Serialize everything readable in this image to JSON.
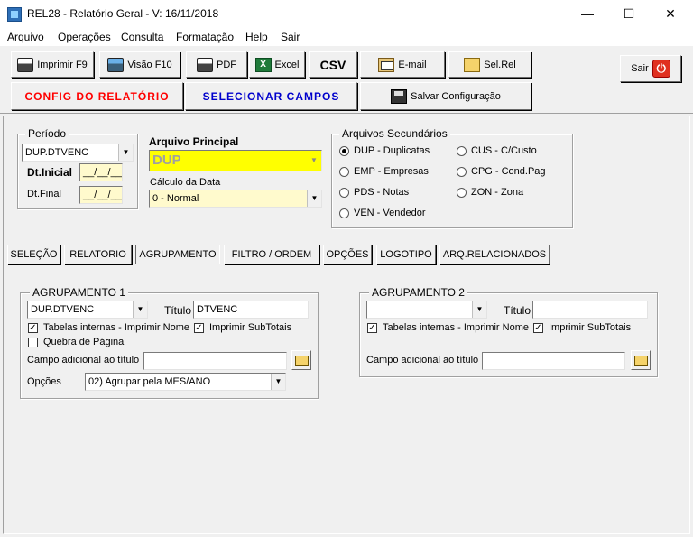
{
  "window": {
    "title": "REL28 - Relatório Geral - V: 16/11/2018",
    "minimize": "—",
    "maximize": "☐",
    "close": "✕"
  },
  "menu": [
    "Arquivo",
    "Operações",
    "Consulta",
    "Formatação",
    "Help",
    "Sair"
  ],
  "toolbar": {
    "print": "Imprimir F9",
    "preview": "Visão F10",
    "pdf": "PDF",
    "excel": "Excel",
    "csv": "CSV",
    "email": "E-mail",
    "selrel": "Sel.Rel",
    "exit": "Sair",
    "config": "CONFIG DO RELATÓRIO",
    "select_fields": "SELECIONAR CAMPOS",
    "save_config": "Salvar Configuração"
  },
  "periodo": {
    "legend": "Período",
    "field": "DUP.DTVENC",
    "dt_inicial_label": "Dt.Inicial",
    "dt_inicial": "__/__/__",
    "dt_final_label": "Dt.Final",
    "dt_final": "__/__/__"
  },
  "arquivo_principal": {
    "label": "Arquivo Principal",
    "value": "DUP",
    "calc_label": "Cálculo da Data",
    "calc_value": "0 - Normal"
  },
  "arquivos_secundarios": {
    "legend": "Arquivos Secundários",
    "options": [
      {
        "label": "DUP - Duplicatas",
        "selected": true
      },
      {
        "label": "EMP - Empresas",
        "selected": false
      },
      {
        "label": "PDS - Notas",
        "selected": false
      },
      {
        "label": "VEN - Vendedor",
        "selected": false
      },
      {
        "label": "CUS - C/Custo",
        "selected": false
      },
      {
        "label": "CPG - Cond.Pag",
        "selected": false
      },
      {
        "label": "ZON - Zona",
        "selected": false
      }
    ]
  },
  "tabs": [
    "SELEÇÃO",
    "RELATORIO",
    "AGRUPAMENTO",
    "FILTRO / ORDEM",
    "OPÇÕES",
    "LOGOTIPO",
    "ARQ.RELACIONADOS"
  ],
  "agrupamento1": {
    "legend": "AGRUPAMENTO 1",
    "field": "DUP.DTVENC",
    "titulo_label": "Título",
    "titulo": "DTVENC",
    "tabelas_internas": "Tabelas internas - Imprimir Nome",
    "subtotais": "Imprimir SubTotais",
    "quebra": "Quebra de Página",
    "campo_adicional": "Campo adicional ao título",
    "opcoes_label": "Opções",
    "opcoes_value": "02) Agrupar pela MES/ANO"
  },
  "agrupamento2": {
    "legend": "AGRUPAMENTO 2",
    "field": "",
    "titulo_label": "Título",
    "titulo": "",
    "tabelas_internas": "Tabelas internas - Imprimir Nome",
    "subtotais": "Imprimir SubTotais",
    "campo_adicional": "Campo adicional ao título"
  }
}
